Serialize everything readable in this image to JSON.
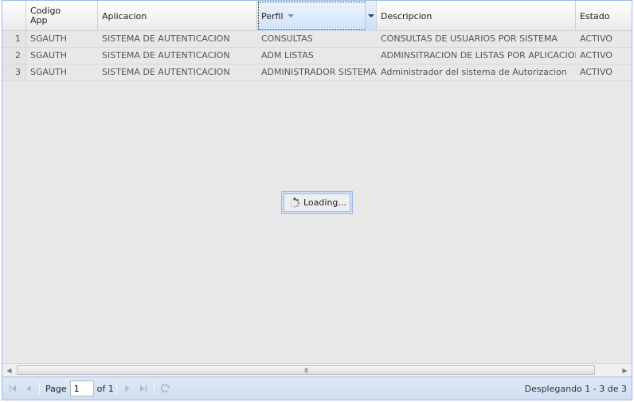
{
  "grid": {
    "columns": [
      {
        "key": "rownum",
        "label": ""
      },
      {
        "key": "codigo_app",
        "label_line1": "Codigo",
        "label_line2": "App"
      },
      {
        "key": "aplicacion",
        "label": "Aplicacion"
      },
      {
        "key": "perfil",
        "label": "Perfil"
      },
      {
        "key": "descripcion",
        "label": "Descripcion"
      },
      {
        "key": "estado",
        "label": "Estado"
      }
    ],
    "rows": [
      {
        "num": "1",
        "codigo_app": "SGAUTH",
        "aplicacion": "SISTEMA DE AUTENTICACION",
        "perfil": "CONSULTAS",
        "descripcion": "CONSULTAS DE USUARIOS POR SISTEMA",
        "estado": "ACTIVO"
      },
      {
        "num": "2",
        "codigo_app": "SGAUTH",
        "aplicacion": "SISTEMA DE AUTENTICACION",
        "perfil": "ADM LISTAS",
        "descripcion": "ADMINSITRACION DE LISTAS POR APLICACION",
        "estado": "ACTIVO"
      },
      {
        "num": "3",
        "codigo_app": "SGAUTH",
        "aplicacion": "SISTEMA DE AUTENTICACION",
        "perfil": "ADMINISTRADOR SISTEMA",
        "descripcion": "Administrador del sistema de Autorizacion",
        "estado": "ACTIVO"
      }
    ]
  },
  "loading": {
    "text": "Loading..."
  },
  "scrollbar": {
    "grip": "III"
  },
  "paging": {
    "page_label": "Page",
    "page_value": "1",
    "of_label": "of 1",
    "display_msg": "Desplegando 1 - 3 de 3"
  },
  "icons": {
    "first": "first-page-icon",
    "prev": "prev-page-icon",
    "next": "next-page-icon",
    "last": "last-page-icon",
    "refresh": "refresh-icon",
    "spinner": "loading-spinner-icon"
  },
  "colors": {
    "accent_border": "#99bbe8",
    "grid_bg": "#e8e8e8",
    "toolbar_bg": "#d0def0"
  }
}
